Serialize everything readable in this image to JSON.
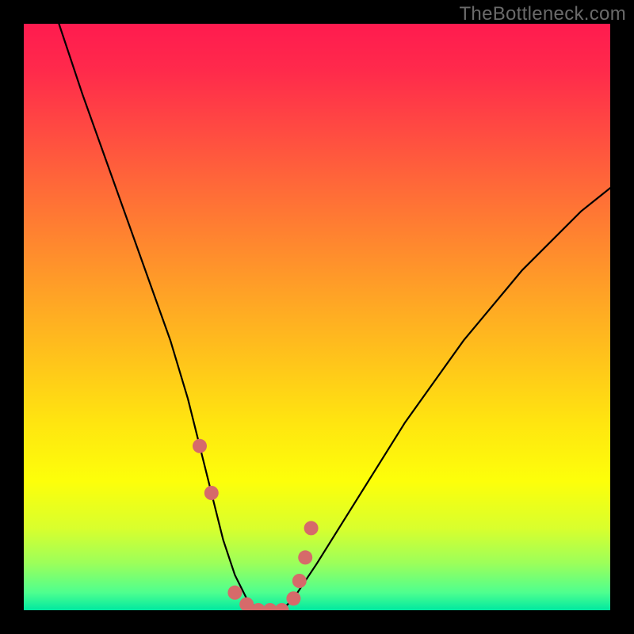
{
  "watermark": "TheBottleneck.com",
  "chart_data": {
    "type": "line",
    "title": "",
    "xlabel": "",
    "ylabel": "",
    "xlim": [
      0,
      100
    ],
    "ylim": [
      0,
      100
    ],
    "series": [
      {
        "name": "bottleneck-curve",
        "x": [
          6,
          10,
          15,
          20,
          25,
          28,
          30,
          32,
          34,
          36,
          38,
          40,
          42,
          44,
          46,
          50,
          55,
          60,
          65,
          70,
          75,
          80,
          85,
          90,
          95,
          100
        ],
        "values": [
          100,
          88,
          74,
          60,
          46,
          36,
          28,
          20,
          12,
          6,
          2,
          0,
          0,
          0,
          2,
          8,
          16,
          24,
          32,
          39,
          46,
          52,
          58,
          63,
          68,
          72
        ]
      }
    ],
    "markers": {
      "name": "highlight-dots",
      "color": "#d66a6a",
      "x": [
        30,
        32,
        36,
        38,
        40,
        42,
        44,
        46,
        47,
        48,
        49
      ],
      "values": [
        28,
        20,
        3,
        1,
        0,
        0,
        0,
        2,
        5,
        9,
        14
      ]
    },
    "gradient_stops": [
      {
        "pos": 0.0,
        "color": "#ff1b4f"
      },
      {
        "pos": 0.28,
        "color": "#ff6a38"
      },
      {
        "pos": 0.58,
        "color": "#ffc61a"
      },
      {
        "pos": 0.78,
        "color": "#fdff0a"
      },
      {
        "pos": 0.92,
        "color": "#9cff5a"
      },
      {
        "pos": 1.0,
        "color": "#00e8a0"
      }
    ]
  }
}
